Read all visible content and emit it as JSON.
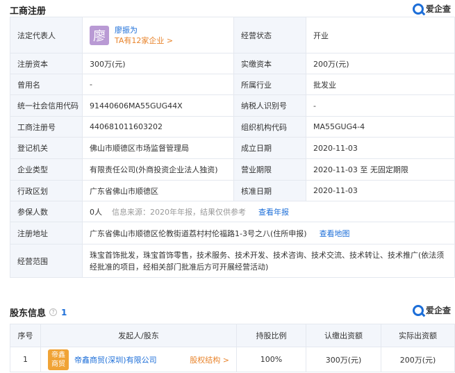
{
  "registration": {
    "title": "工商注册",
    "brand": "爱企查",
    "legal_rep": {
      "label": "法定代表人",
      "avatar_char": "廖",
      "name": "廖振为",
      "companies_link": "TA有12家企业 >"
    },
    "rows": [
      {
        "l1": "法定代表人",
        "v1": "",
        "l2": "经营状态",
        "v2": "开业"
      },
      {
        "l1": "注册资本",
        "v1": "300万(元)",
        "l2": "实缴资本",
        "v2": "200万(元)"
      },
      {
        "l1": "曾用名",
        "v1": "-",
        "l2": "所属行业",
        "v2": "批发业"
      },
      {
        "l1": "统一社会信用代码",
        "v1": "91440606MA55GUG44X",
        "l2": "纳税人识别号",
        "v2": "-"
      },
      {
        "l1": "工商注册号",
        "v1": "440681011603202",
        "l2": "组织机构代码",
        "v2": "MA55GUG4-4"
      },
      {
        "l1": "登记机关",
        "v1": "佛山市顺德区市场监督管理局",
        "l2": "成立日期",
        "v2": "2020-11-03"
      },
      {
        "l1": "企业类型",
        "v1": "有限责任公司(外商投资企业法人独资)",
        "l2": "营业期限",
        "v2": "2020-11-03 至 无固定期限"
      },
      {
        "l1": "行政区划",
        "v1": "广东省佛山市顺德区",
        "l2": "核准日期",
        "v2": "2020-11-03"
      }
    ],
    "insured": {
      "label": "参保人数",
      "value": "0人",
      "source": "信息来源：2020年年报，结果仅供参考",
      "link": "查看年报"
    },
    "address": {
      "label": "注册地址",
      "value": "广东省佛山市顺德区伦教街道荔村村伦福路1-3号之八(住所申报)",
      "link": "查看地图"
    },
    "scope": {
      "label": "经营范围",
      "value": "珠宝首饰批发，珠宝首饰零售，技术服务、技术开发、技术咨询、技术交流、技术转让、技术推广(依法须经批准的项目，经相关部门批准后方可开展经营活动)"
    }
  },
  "shareholders": {
    "title": "股东信息",
    "count": "1",
    "brand": "爱企查",
    "headers": [
      "序号",
      "发起人/股东",
      "持股比例",
      "认缴出资额",
      "实际出资额"
    ],
    "rows": [
      {
        "index": "1",
        "logo_line1": "帝鑫",
        "logo_line2": "商贸",
        "name": "帝鑫商贸(深圳)有限公司",
        "struct_link": "股权结构 >",
        "ratio": "100%",
        "subscribed": "300万(元)",
        "paid": "200万(元)"
      }
    ]
  }
}
